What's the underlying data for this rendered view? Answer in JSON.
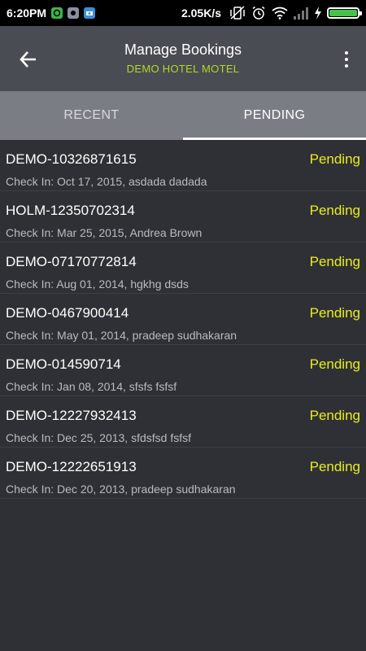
{
  "status_bar": {
    "time": "6:20PM",
    "network_speed": "2.05K/s",
    "notification_icons": [
      "chat-app-icon",
      "photo-app-icon",
      "camera-app-icon"
    ],
    "battery_level": 1.0
  },
  "app_bar": {
    "title": "Manage Bookings",
    "subtitle": "DEMO HOTEL MOTEL"
  },
  "tabs": [
    {
      "label": "RECENT",
      "active": false
    },
    {
      "label": "PENDING",
      "active": true
    }
  ],
  "bookings": [
    {
      "id": "DEMO-10326871615",
      "detail": "Check In: Oct 17, 2015, asdada dadada",
      "status": "Pending"
    },
    {
      "id": "HOLM-12350702314",
      "detail": "Check In: Mar 25, 2015, Andrea Brown",
      "status": "Pending"
    },
    {
      "id": "DEMO-07170772814",
      "detail": "Check In: Aug 01, 2014, hgkhg dsds",
      "status": "Pending"
    },
    {
      "id": "DEMO-0467900414",
      "detail": "Check In: May 01, 2014, pradeep sudhakaran",
      "status": "Pending"
    },
    {
      "id": "DEMO-014590714",
      "detail": "Check In: Jan 08, 2014, sfsfs fsfsf",
      "status": "Pending"
    },
    {
      "id": "DEMO-12227932413",
      "detail": "Check In: Dec 25, 2013, sfdsfsd fsfsf",
      "status": "Pending"
    },
    {
      "id": "DEMO-12222651913",
      "detail": "Check In: Dec 20, 2013, pradeep sudhakaran",
      "status": "Pending"
    }
  ],
  "colors": {
    "accent_subtitle": "#b5d62a",
    "status_pending": "#e8ee1c",
    "background": "#2f3035",
    "app_bar": "#4a4c53",
    "tab_bar": "#7a7d84"
  }
}
